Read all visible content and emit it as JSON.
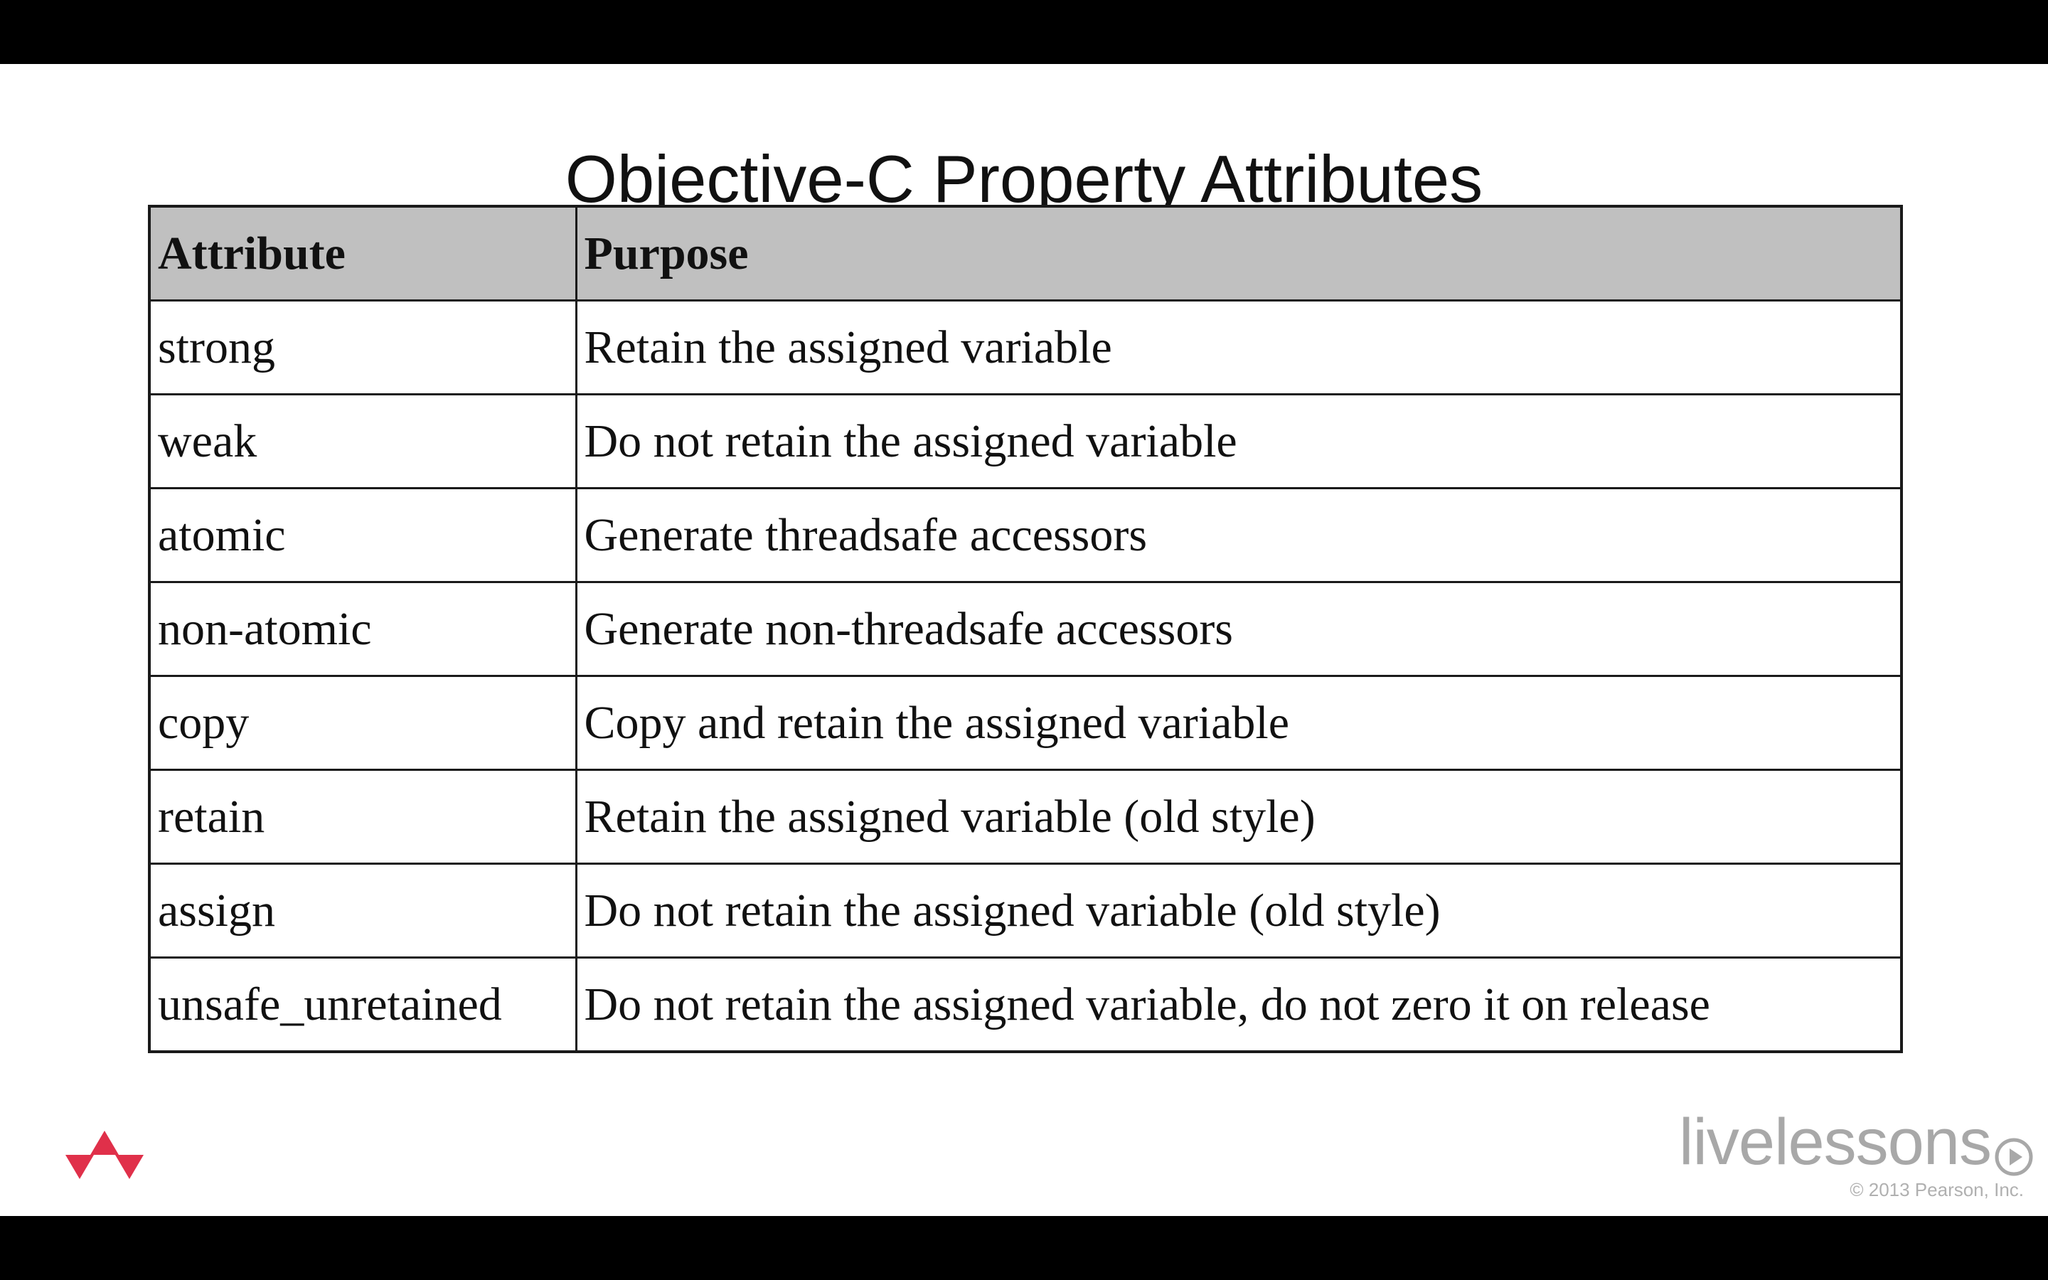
{
  "slide": {
    "title": "Objective-C Property Attributes"
  },
  "table": {
    "headers": [
      "Attribute",
      "Purpose"
    ],
    "rows": [
      [
        "strong",
        "Retain the assigned variable"
      ],
      [
        "weak",
        "Do not retain the assigned variable"
      ],
      [
        "atomic",
        "Generate threadsafe accessors"
      ],
      [
        "non-atomic",
        "Generate non-threadsafe accessors"
      ],
      [
        "copy",
        "Copy and retain the assigned variable"
      ],
      [
        "retain",
        "Retain the assigned variable (old style)"
      ],
      [
        "assign",
        "Do not retain the assigned variable (old style)"
      ],
      [
        "unsafe_unretained",
        "Do not retain the assigned variable, do not zero it on release"
      ]
    ]
  },
  "branding": {
    "logo_icon": "publisher-triangle-logo",
    "wordmark_live": "live",
    "wordmark_lessons": "lessons",
    "play_icon": "play-circle-icon",
    "copyright": "© 2013 Pearson, Inc."
  },
  "colors": {
    "header_bg": "#c0c0c0",
    "logo_red": "#e0304a",
    "brand_gray": "#a8a8a8"
  }
}
